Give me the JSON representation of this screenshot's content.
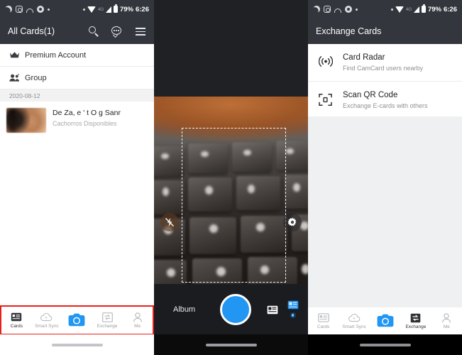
{
  "statusbar": {
    "icons": [
      "dnd-moon-icon",
      "screen-record-icon",
      "arc-icon",
      "circle-dot-icon",
      "small-dot-icon",
      "small-dot-icon"
    ],
    "wifi_icon": "wifi-icon",
    "network_label": "4G",
    "signal_icon": "signal-icon",
    "battery_icon": "battery-icon",
    "battery_text": "79%",
    "time": "6:26"
  },
  "theme": {
    "appbar_bg": "#33373d",
    "accent_blue": "#2196f3",
    "highlight_red": "#e8201b",
    "camera_panel_bg": "#1b1c1f"
  },
  "panel_cards": {
    "appbar": {
      "title": "All Cards(1)",
      "actions": [
        {
          "name": "search-icon",
          "label": "Search"
        },
        {
          "name": "chat-icon",
          "label": "Chat"
        },
        {
          "name": "menu-icon",
          "label": "Menu"
        }
      ]
    },
    "rows": [
      {
        "icon": "crown-icon",
        "label": "Premium Account"
      },
      {
        "icon": "group-icon",
        "label": "Group"
      }
    ],
    "date_header": "2020-08-12",
    "card": {
      "thumbnail": "card-thumbnail",
      "name": "De Za, e ' t O g Sanr",
      "subtitle": "Cachorros Disponibles"
    },
    "nav": [
      {
        "icon": "cards-icon",
        "label": "Cards",
        "active": true
      },
      {
        "icon": "smart-sync-icon",
        "label": "Smart Sync",
        "active": false
      },
      {
        "icon": "camera-icon",
        "label": "",
        "active": false
      },
      {
        "icon": "exchange-icon",
        "label": "Exchange",
        "active": false
      },
      {
        "icon": "me-icon",
        "label": "Me",
        "active": false
      }
    ]
  },
  "panel_camera": {
    "flash_button": "flash-off-icon",
    "settings_button": "gear-icon",
    "scan_frame": "scan-frame",
    "album_label": "Album",
    "shutter_button": "shutter-button",
    "card_mode_icon": "card-mode-icon",
    "multi_mode_icon": "multi-capture-icon",
    "mode_indicator": "mode-indicator-dot"
  },
  "panel_exchange": {
    "appbar": {
      "title": "Exchange Cards"
    },
    "rows": [
      {
        "icon": "radar-icon",
        "title": "Card Radar",
        "subtitle": "Find CamCard users nearby"
      },
      {
        "icon": "qr-icon",
        "title": "Scan QR Code",
        "subtitle": "Exchange E-cards with others"
      }
    ],
    "nav": [
      {
        "icon": "cards-icon",
        "label": "Cards",
        "active": false
      },
      {
        "icon": "smart-sync-icon",
        "label": "Smart Sync",
        "active": false
      },
      {
        "icon": "camera-icon",
        "label": "",
        "active": false
      },
      {
        "icon": "exchange-icon",
        "label": "Exchange",
        "active": true
      },
      {
        "icon": "me-icon",
        "label": "Me",
        "active": false
      }
    ]
  }
}
